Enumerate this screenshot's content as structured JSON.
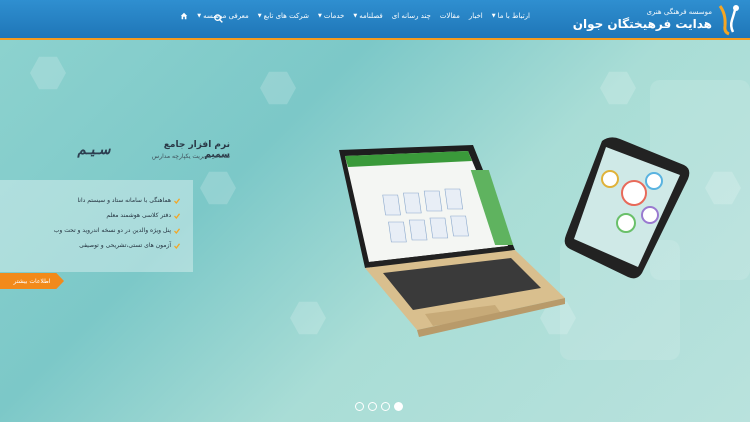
{
  "header": {
    "logo_sub": "موسسه فرهنگی هنری",
    "logo_title": "هدایت فرهیختگان جوان",
    "nav": [
      "معرفی موسسه",
      "شرکت های تابع",
      "خدمات",
      "فصلنامه",
      "چند رسانه ای",
      "مقالات",
      "اخبار",
      "ارتباط با ما"
    ],
    "nav_has_caret": [
      true,
      true,
      true,
      true,
      false,
      false,
      false,
      true
    ]
  },
  "hero": {
    "brand_title": "نرم افزار جامع سمیم",
    "brand_sub": "سامانه مدیریت یکپارچه مدارس",
    "features": [
      "هماهنگی با سامانه ستاد و سیستم دانا",
      "دفتر کلاسی هوشمند معلم",
      "پنل ویژه والدین در دو نسخه اندروید و تحت وب",
      "آزمون های تستی،تشریحی و توصیفی"
    ],
    "more_label": "اطلاعات بیشتر",
    "slides": 4,
    "active_slide": 4
  },
  "colors": {
    "header": "#1f76b8",
    "accent": "#f28a1a",
    "check": "#f5a623"
  },
  "icons": {
    "home": "home-icon",
    "search": "search-icon",
    "check": "check-icon"
  }
}
